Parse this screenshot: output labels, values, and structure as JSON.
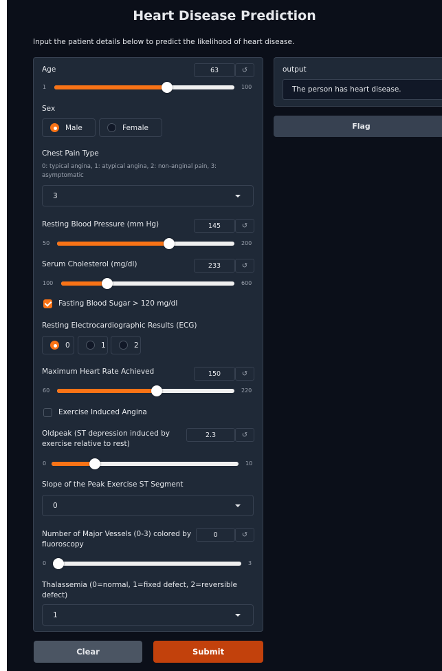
{
  "header": {
    "title": "Heart Disease Prediction",
    "subtitle": "Input the patient details below to predict the likelihood of heart disease."
  },
  "form": {
    "age": {
      "label": "Age",
      "value": "63",
      "min": "1",
      "max": "100",
      "fraction": 0.626
    },
    "sex": {
      "label": "Sex",
      "options": [
        "Male",
        "Female"
      ],
      "selected": "Male"
    },
    "chest_pain": {
      "label": "Chest Pain Type",
      "info": "0: typical angina, 1: atypical angina, 2: non-anginal pain, 3: asymptomatic",
      "value": "3"
    },
    "resting_bp": {
      "label": "Resting Blood Pressure (mm Hg)",
      "value": "145",
      "min": "50",
      "max": "200",
      "fraction": 0.633
    },
    "cholesterol": {
      "label": "Serum Cholesterol (mg/dl)",
      "value": "233",
      "min": "100",
      "max": "600",
      "fraction": 0.266
    },
    "fasting_bs": {
      "label": "Fasting Blood Sugar > 120 mg/dl",
      "checked": true
    },
    "ecg": {
      "label": "Resting Electrocardiographic Results (ECG)",
      "options": [
        "0",
        "1",
        "2"
      ],
      "selected": "0"
    },
    "max_hr": {
      "label": "Maximum Heart Rate Achieved",
      "value": "150",
      "min": "60",
      "max": "220",
      "fraction": 0.5625
    },
    "exang": {
      "label": "Exercise Induced Angina",
      "checked": false
    },
    "oldpeak": {
      "label": "Oldpeak (ST depression induced by exercise relative to rest)",
      "value": "2.3",
      "min": "0",
      "max": "10",
      "fraction": 0.23
    },
    "slope": {
      "label": "Slope of the Peak Exercise ST Segment",
      "value": "0"
    },
    "vessels": {
      "label": "Number of Major Vessels (0-3) colored by fluoroscopy",
      "value": "0",
      "min": "0",
      "max": "3",
      "fraction": 0.0
    },
    "thal": {
      "label": "Thalassemia (0=normal, 1=fixed defect, 2=reversible defect)",
      "value": "1"
    }
  },
  "output": {
    "label": "output",
    "value": "The person has heart disease."
  },
  "buttons": {
    "flag": "Flag",
    "clear": "Clear",
    "submit": "Submit"
  },
  "icons": {
    "reset": "↺"
  },
  "colors": {
    "accent": "#f97316",
    "background": "#0b0f19",
    "panel": "#1f2937",
    "submit": "#c2410c"
  }
}
